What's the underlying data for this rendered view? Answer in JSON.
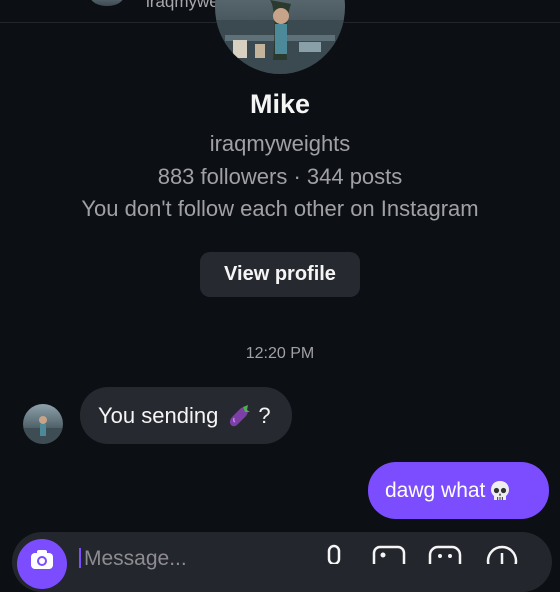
{
  "header": {
    "handle": "iraqmyweights"
  },
  "profile": {
    "name": "Mike",
    "username": "iraqmyweights",
    "stats": "883 followers · 344 posts",
    "relationship": "You don't follow each other on Instagram",
    "view_profile_label": "View profile"
  },
  "chat": {
    "timestamp": "12:20 PM",
    "incoming": {
      "text": "You sending",
      "emoji": "eggplant-emoji",
      "suffix": "?"
    },
    "outgoing": {
      "text": "dawg what",
      "emoji": "skull-emoji"
    }
  },
  "composer": {
    "placeholder": "Message...",
    "icons": [
      "camera-icon",
      "microphone-icon",
      "image-icon",
      "sticker-icon",
      "plus-icon"
    ]
  },
  "colors": {
    "background": "#0c0f14",
    "accent": "#7c4dff",
    "bubble": "#26292f"
  }
}
